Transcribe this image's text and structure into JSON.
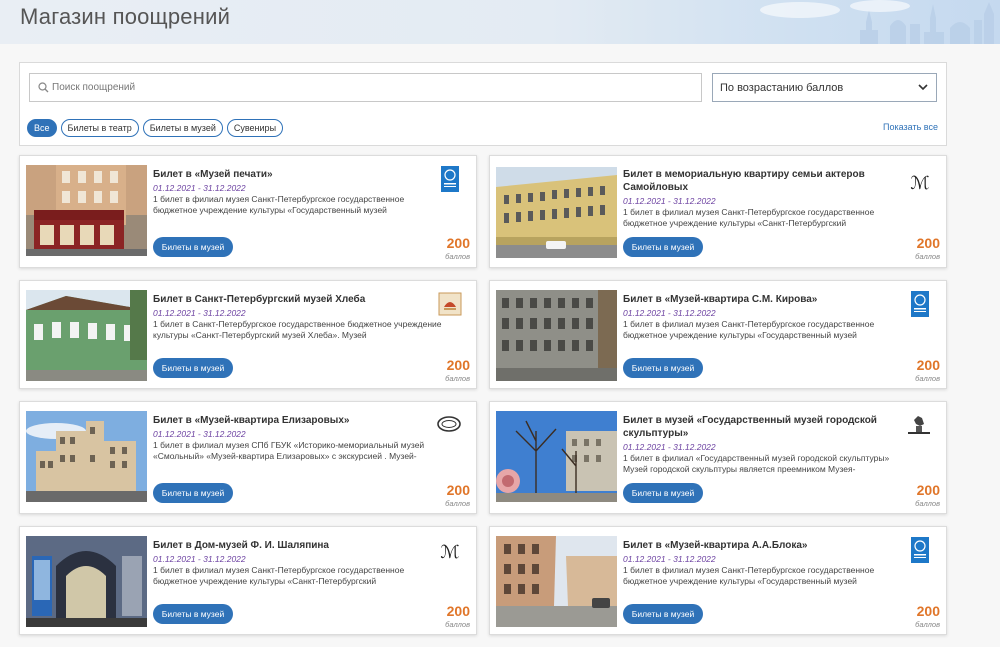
{
  "header": {
    "title": "Магазин поощрений"
  },
  "search": {
    "placeholder": "Поиск поощрений"
  },
  "sort": {
    "selected": "По возрастанию баллов"
  },
  "filters": {
    "chips": [
      "Все",
      "Билеты в театр",
      "Билеты в музей",
      "Сувениры"
    ],
    "active": "Все",
    "show_all": "Показать все"
  },
  "colors": {
    "accent": "#2f72b8",
    "points": "#e0762a",
    "dates": "#6a3fa0"
  },
  "cards": [
    {
      "title": "Билет в «Музей печати»",
      "dates": "01.12.2021 - 31.12.2022",
      "desc": "1 билет в филиал музея Санкт-Петербургское государственное бюджетное учреждение культуры «Государственный музей",
      "category": "Билеты в музей",
      "points": "200",
      "points_label": "баллов",
      "logo": "museum-history-logo-icon"
    },
    {
      "title": "Билет в мемориальную квартиру семьи актеров Самойловых",
      "dates": "01.12.2021 - 31.12.2022",
      "desc": "1 билет в филиал музея Санкт-Петербургское государственное бюджетное учреждение культуры «Санкт-Петербургский",
      "category": "Билеты в музей",
      "points": "200",
      "points_label": "баллов",
      "logo": "theatre-museum-logo-icon"
    },
    {
      "title": "Билет в Санкт-Петербургский музей Хлеба",
      "dates": "01.12.2021 - 31.12.2022",
      "desc": "1 билет в Санкт-Петербургское государственное бюджетное учреждение культуры «Санкт-Петербургский музей Хлеба». Музей",
      "category": "Билеты в музей",
      "points": "200",
      "points_label": "баллов",
      "logo": "bread-museum-logo-icon"
    },
    {
      "title": "Билет в «Музей-квартира С.М. Кирова»",
      "dates": "01.12.2021 - 31.12.2022",
      "desc": "1 билет в филиал музея Санкт-Петербургское государственное бюджетное учреждение культуры «Государственный музей",
      "category": "Билеты в музей",
      "points": "200",
      "points_label": "баллов",
      "logo": "museum-history-logo-icon"
    },
    {
      "title": "Билет в «Музей-квартира Елизаровых»",
      "dates": "01.12.2021 - 31.12.2022",
      "desc": "1 билет в филиал музея СПб ГБУК «Историко-мемориальный музей «Смольный» «Музей-квартира Елизаровых» с экскурсией . Музей-",
      "category": "Билеты в музей",
      "points": "200",
      "points_label": "баллов",
      "logo": "smolny-museum-logo-icon"
    },
    {
      "title": "Билет в музей «Государственный музей городской скульптуры»",
      "dates": "01.12.2021 - 31.12.2022",
      "desc": "1 билет в филиал «Государственный музей городской скульптуры» Музей городской скульптуры является преемником Музея-",
      "category": "Билеты в музей",
      "points": "200",
      "points_label": "баллов",
      "logo": "sculpture-museum-logo-icon"
    },
    {
      "title": "Билет в Дом-музей Ф. И. Шаляпина",
      "dates": "01.12.2021 - 31.12.2022",
      "desc": "1 билет в филиал музея Санкт-Петербургское государственное бюджетное учреждение культуры «Санкт-Петербургский",
      "category": "Билеты в музей",
      "points": "200",
      "points_label": "баллов",
      "logo": "theatre-museum-logo-icon"
    },
    {
      "title": "Билет в «Музей-квартира А.А.Блока»",
      "dates": "01.12.2021 - 31.12.2022",
      "desc": "1 билет в филиал музея Санкт-Петербургское государственное бюджетное учреждение культуры «Государственный музей",
      "category": "Билеты в музей",
      "points": "200",
      "points_label": "баллов",
      "logo": "museum-history-logo-icon"
    }
  ]
}
